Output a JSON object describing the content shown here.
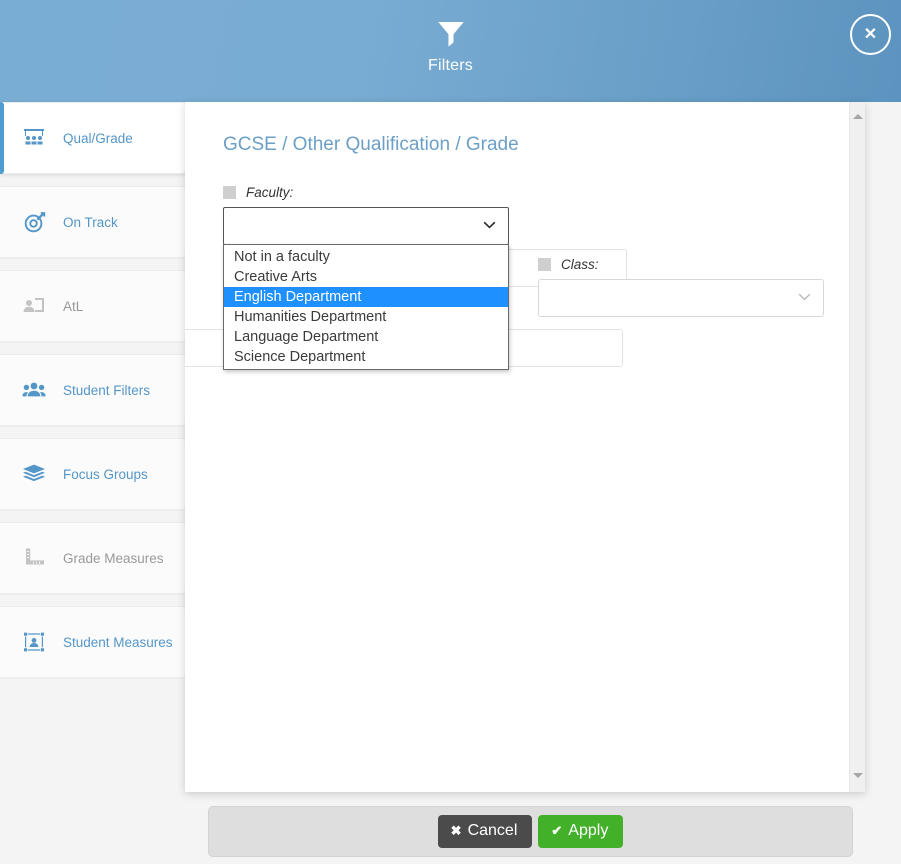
{
  "header": {
    "title": "Filters",
    "icon": "funnel-icon",
    "close_label": "✕",
    "bg_start": "#7aadd4",
    "bg_end": "#5c94bf"
  },
  "sidebar": {
    "items": [
      {
        "label": "Qual/Grade",
        "icon": "classroom-icon",
        "state": "active"
      },
      {
        "label": "On Track",
        "icon": "target-icon",
        "state": "enabled"
      },
      {
        "label": "AtL",
        "icon": "user-card-icon",
        "state": "disabled"
      },
      {
        "label": "Student Filters",
        "icon": "users-icon",
        "state": "enabled"
      },
      {
        "label": "Focus Groups",
        "icon": "layers-icon",
        "state": "enabled"
      },
      {
        "label": "Grade Measures",
        "icon": "ruler-icon",
        "state": "disabled"
      },
      {
        "label": "Student Measures",
        "icon": "frame-icon",
        "state": "enabled"
      }
    ]
  },
  "main": {
    "title": "GCSE / Other Qualification / Grade",
    "faculty_field": {
      "label": "Faculty:",
      "value": "",
      "placeholder": "",
      "checkbox_checked": false,
      "dropdown_open": true,
      "options": [
        "Not in a faculty",
        "Creative Arts",
        "English Department",
        "Humanities Department",
        "Language Department",
        "Science Department"
      ],
      "selected_option": "English Department"
    },
    "class_field": {
      "label": "Class:",
      "value": "",
      "placeholder": "",
      "checkbox_checked": false
    }
  },
  "scrollbar": {
    "up_arrow": "triangle-up",
    "down_arrow": "triangle-down"
  },
  "footer": {
    "cancel_label": "Cancel",
    "cancel_glyph": "✖",
    "apply_label": "Apply",
    "apply_glyph": "✔",
    "cancel_color": "#4b4b4b",
    "apply_color": "#43b02a"
  }
}
